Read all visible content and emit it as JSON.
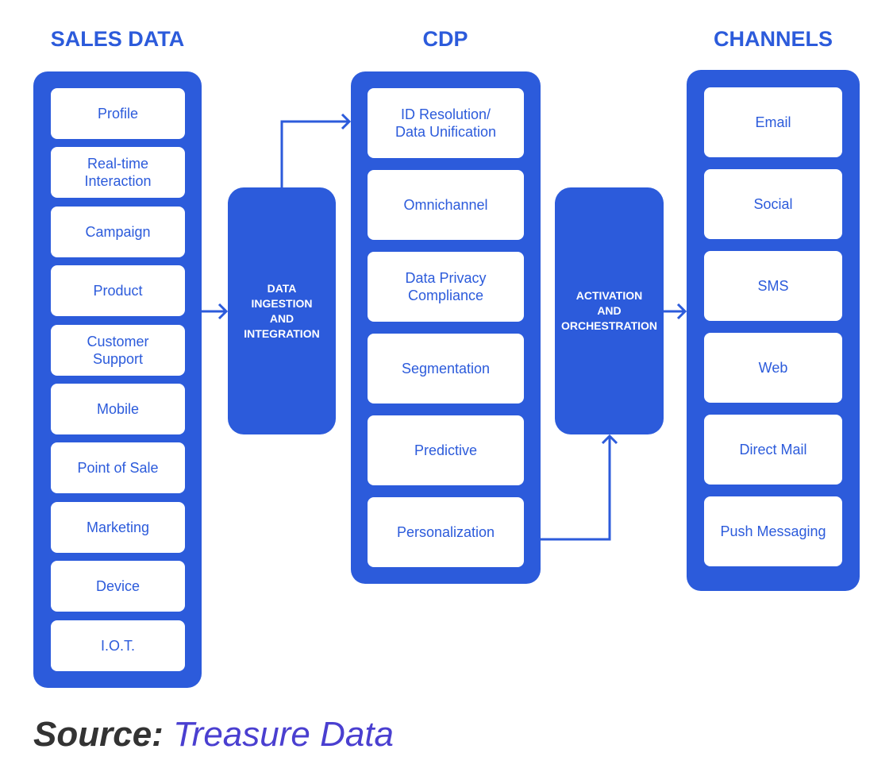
{
  "headings": {
    "sales": "SALES DATA",
    "cdp": "CDP",
    "channels": "CHANNELS"
  },
  "sales_items": [
    "Profile",
    "Real-time\nInteraction",
    "Campaign",
    "Product",
    "Customer\nSupport",
    "Mobile",
    "Point of Sale",
    "Marketing",
    "Device",
    "I.O.T."
  ],
  "ingestion": "DATA\nINGESTION\nAND\nINTEGRATION",
  "cdp_items": [
    "ID Resolution/\nData Unification",
    "Omnichannel",
    "Data Privacy\nCompliance",
    "Segmentation",
    "Predictive",
    "Personalization"
  ],
  "activation": "ACTIVATION\nAND\nORCHESTRATION",
  "channel_items": [
    "Email",
    "Social",
    "SMS",
    "Web",
    "Direct Mail",
    "Push Messaging"
  ],
  "source": {
    "label": "Source:",
    "value": "Treasure Data"
  },
  "colors": {
    "primary": "#2c5bdb",
    "source_link": "#4a3fd0"
  }
}
